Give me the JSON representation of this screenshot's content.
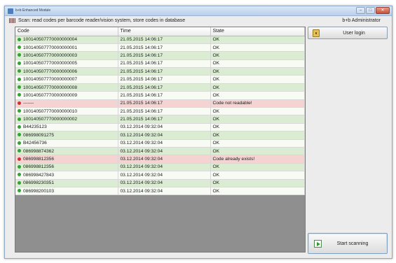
{
  "window": {
    "title": "b+b Enhanced Module"
  },
  "header": {
    "scan_text": "Scan: read codes per barcode reader/vision system, store codes in database",
    "user_name": "b+b Administrator"
  },
  "table": {
    "columns": [
      "Code",
      "Time",
      "State"
    ],
    "rows": [
      {
        "code": "100140507770000000004",
        "time": "21.05.2015 14:06:17",
        "state": "OK",
        "status": "ok"
      },
      {
        "code": "100140507770000000001",
        "time": "21.05.2015 14:06:17",
        "state": "OK",
        "status": "ok"
      },
      {
        "code": "100140507770000000003",
        "time": "21.05.2015 14:06:17",
        "state": "OK",
        "status": "ok"
      },
      {
        "code": "100140507770000000005",
        "time": "21.05.2015 14:06:17",
        "state": "OK",
        "status": "ok"
      },
      {
        "code": "100140507770000000006",
        "time": "21.05.2015 14:06:17",
        "state": "OK",
        "status": "ok"
      },
      {
        "code": "100140507770000000007",
        "time": "21.05.2015 14:06:17",
        "state": "OK",
        "status": "ok"
      },
      {
        "code": "100140507770000000008",
        "time": "21.05.2015 14:06:17",
        "state": "OK",
        "status": "ok"
      },
      {
        "code": "100140507770000000009",
        "time": "21.05.2015 14:06:17",
        "state": "OK",
        "status": "ok"
      },
      {
        "code": "-------",
        "time": "21.05.2015 14:06:17",
        "state": "Code not readable!",
        "status": "error"
      },
      {
        "code": "100140507770000000010",
        "time": "21.05.2015 14:06:17",
        "state": "OK",
        "status": "ok"
      },
      {
        "code": "100140507770000000002",
        "time": "21.05.2015 14:06:17",
        "state": "OK",
        "status": "ok"
      },
      {
        "code": "B44235123",
        "time": "03.12.2014 09:32:04",
        "state": "OK",
        "status": "ok"
      },
      {
        "code": "086998091275",
        "time": "03.12.2014 09:32:04",
        "state": "OK",
        "status": "ok"
      },
      {
        "code": "B42456736",
        "time": "03.12.2014 09:32:04",
        "state": "OK",
        "status": "ok"
      },
      {
        "code": "086998874362",
        "time": "03.12.2014 09:32:04",
        "state": "OK",
        "status": "ok"
      },
      {
        "code": "086998812356",
        "time": "03.12.2014 09:32:04",
        "state": "Code already exists!",
        "status": "error"
      },
      {
        "code": "086998812356",
        "time": "03.12.2014 09:32:04",
        "state": "OK",
        "status": "ok"
      },
      {
        "code": "086998427843",
        "time": "03.12.2014 09:32:04",
        "state": "OK",
        "status": "ok"
      },
      {
        "code": "086998230351",
        "time": "03.12.2014 09:32:04",
        "state": "OK",
        "status": "ok"
      },
      {
        "code": "086998200103",
        "time": "03.12.2014 09:32:04",
        "state": "OK",
        "status": "ok"
      }
    ]
  },
  "buttons": {
    "login_label": "User login",
    "login_icon": "key-icon",
    "scan_label": "Start scanning",
    "scan_icon": "play-icon"
  },
  "colors": {
    "row_ok_even": "#daecd2",
    "row_ok_odd": "#f7fbf4",
    "row_error": "#f5d3d3",
    "status_ok": "#33a233",
    "status_error": "#d42e2e",
    "empty_area": "#8f8f8f"
  }
}
